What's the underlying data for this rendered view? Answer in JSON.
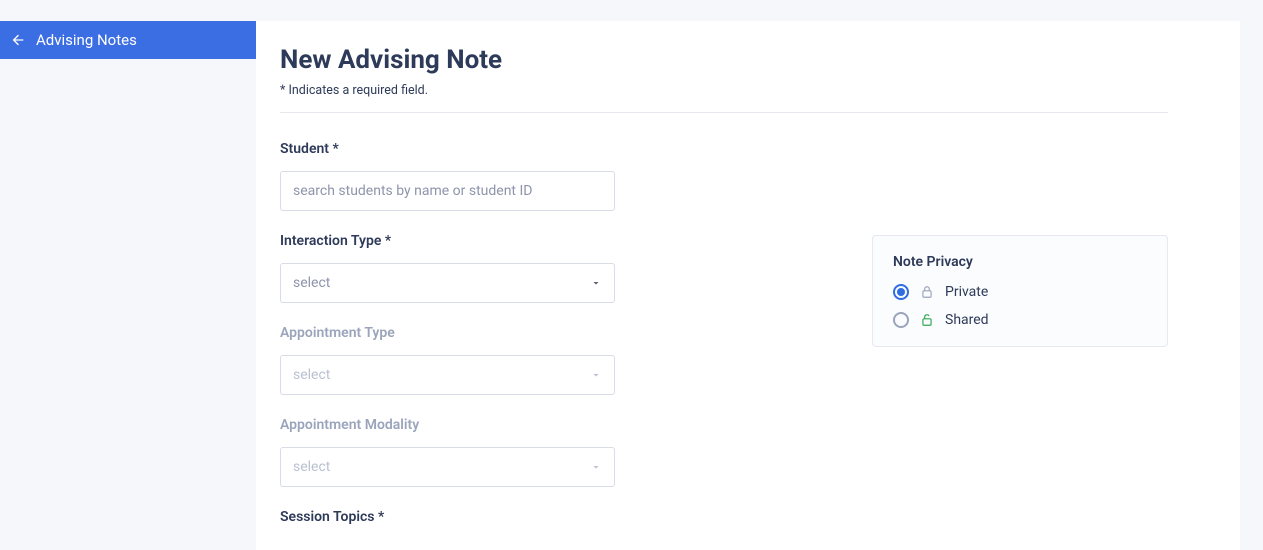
{
  "sidebar": {
    "back_label": "Advising Notes"
  },
  "header": {
    "title": "New Advising Note",
    "required_note": "* Indicates a required field."
  },
  "form": {
    "student": {
      "label": "Student *",
      "placeholder": "search students by name or student ID"
    },
    "interaction_type": {
      "label": "Interaction Type *",
      "value": "select"
    },
    "appointment_type": {
      "label": "Appointment Type",
      "value": "select"
    },
    "appointment_modality": {
      "label": "Appointment Modality",
      "value": "select"
    },
    "session_topics": {
      "label": "Session Topics *"
    }
  },
  "privacy": {
    "title": "Note Privacy",
    "options": {
      "private": {
        "label": "Private",
        "selected": true
      },
      "shared": {
        "label": "Shared",
        "selected": false
      }
    }
  }
}
